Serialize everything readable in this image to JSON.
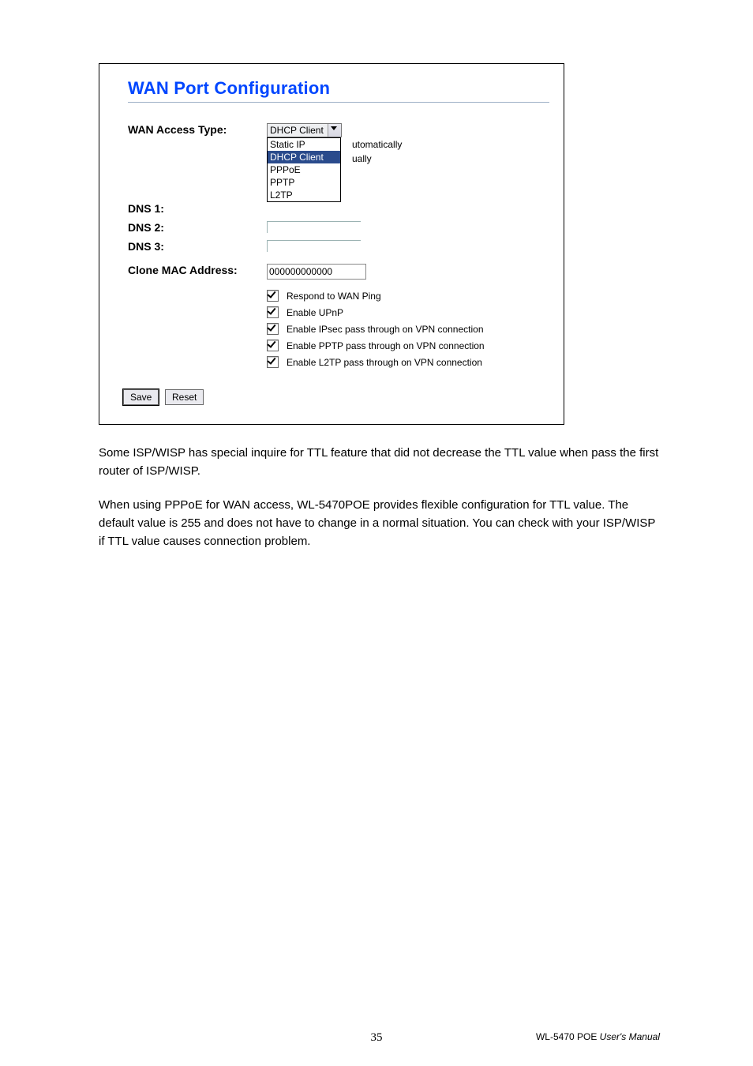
{
  "panelTitle": "WAN Port Configuration",
  "form": {
    "wanAccessType": {
      "label": "WAN Access Type:",
      "selected": "DHCP Client",
      "options": [
        "Static IP",
        "DHCP Client",
        "PPPoE",
        "PPTP",
        "L2TP"
      ]
    },
    "bgRadioFragments": {
      "auto": "utomatically",
      "manual": "ually"
    },
    "dns1": {
      "label": "DNS 1:",
      "value": ""
    },
    "dns2": {
      "label": "DNS 2:",
      "value": ""
    },
    "dns3": {
      "label": "DNS 3:",
      "value": ""
    },
    "cloneMac": {
      "label": "Clone MAC Address:",
      "value": "000000000000"
    },
    "checkboxes": {
      "respondPing": {
        "label": "Respond to WAN Ping",
        "checked": true
      },
      "upnp": {
        "label": "Enable UPnP",
        "checked": true
      },
      "ipsec": {
        "label": "Enable IPsec pass through on VPN connection",
        "checked": true
      },
      "pptp": {
        "label": "Enable PPTP pass through on VPN connection",
        "checked": true
      },
      "l2tp": {
        "label": "Enable L2TP pass through on VPN connection",
        "checked": true
      }
    },
    "buttons": {
      "save": "Save",
      "reset": "Reset"
    }
  },
  "paragraph1": "Some ISP/WISP has special inquire for TTL feature that did not decrease the TTL value when pass the first router of ISP/WISP.",
  "paragraph2": "When using PPPoE for WAN access, WL-5470POE provides flexible configuration for TTL value. The default value is 255 and does not have to change in a normal situation. You can check with your ISP/WISP if TTL value causes connection problem.",
  "footer": {
    "page": "35",
    "product": "WL-5470 POE",
    "doc": " User's Manual"
  }
}
